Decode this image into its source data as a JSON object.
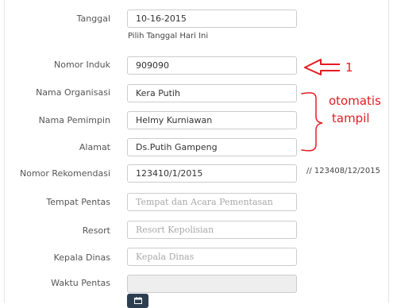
{
  "form": {
    "tanggal": {
      "label": "Tanggal",
      "value": "10-16-2015",
      "help": "Pilih Tanggal Hari Ini"
    },
    "nomor_induk": {
      "label": "Nomor Induk",
      "value": "909090"
    },
    "nama_organisasi": {
      "label": "Nama Organisasi",
      "value": "Kera Putih"
    },
    "nama_pimpinan": {
      "label": "Nama Pemimpin",
      "value": "Helmy Kurniawan"
    },
    "alamat": {
      "label": "Alamat",
      "value": "Ds.Putih Gampeng"
    },
    "nomor_rekomendasi": {
      "label": "Nomor Rekomendasi",
      "value": "123410/1/2015",
      "note": "// 123408/12/2015"
    },
    "tempat_pentas": {
      "label": "Tempat Pentas",
      "value": "",
      "placeholder": "Tempat dan Acara Pementasan"
    },
    "resort": {
      "label": "Resort",
      "value": "",
      "placeholder": "Resort Kepolisian"
    },
    "kepala_dinas": {
      "label": "Kepala Dinas",
      "value": "",
      "placeholder": "Kepala Dinas"
    },
    "waktu_pentas": {
      "label": "Waktu Pentas",
      "value": ""
    }
  },
  "calendar_button": {
    "icon": "calendar-icon"
  },
  "annotations": {
    "arrow_label": "1",
    "brace_label_line1": "otomatis",
    "brace_label_line2": "tampil",
    "color": "#e31b23"
  }
}
